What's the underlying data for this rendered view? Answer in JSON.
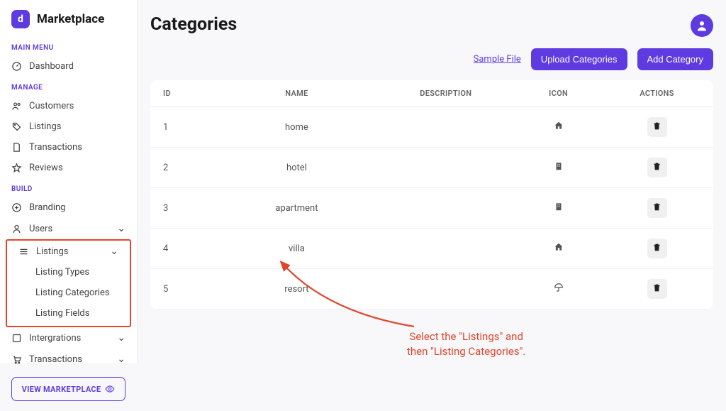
{
  "brand": {
    "mark": "d",
    "name": "Marketplace"
  },
  "sidebar": {
    "main_menu_header": "MAIN MENU",
    "manage_header": "MANAGE",
    "build_header": "BUILD",
    "dashboard": "Dashboard",
    "customers": "Customers",
    "listings": "Listings",
    "transactions": "Transactions",
    "reviews": "Reviews",
    "branding": "Branding",
    "users": "Users",
    "build_listings": "Listings",
    "listing_types": "Listing Types",
    "listing_categories": "Listing Categories",
    "listing_fields": "Listing Fields",
    "integrations": "Intergrations",
    "build_transactions": "Transactions",
    "view_marketplace": "VIEW MARKETPLACE"
  },
  "header": {
    "title": "Categories",
    "sample_file": "Sample File",
    "upload_btn": "Upload Categories",
    "add_btn": "Add Category"
  },
  "table": {
    "columns": {
      "id": "ID",
      "name": "NAME",
      "description": "DESCRIPTION",
      "icon": "ICON",
      "actions": "ACTIONS"
    },
    "rows": [
      {
        "id": "1",
        "name": "home",
        "icon": "home"
      },
      {
        "id": "2",
        "name": "hotel",
        "icon": "building"
      },
      {
        "id": "3",
        "name": "apartment",
        "icon": "building"
      },
      {
        "id": "4",
        "name": "villa",
        "icon": "home"
      },
      {
        "id": "5",
        "name": "resort",
        "icon": "umbrella"
      }
    ]
  },
  "annotation": {
    "line1": "Select the \"Listings\" and",
    "line2": "then \"Listing Categories\"."
  }
}
